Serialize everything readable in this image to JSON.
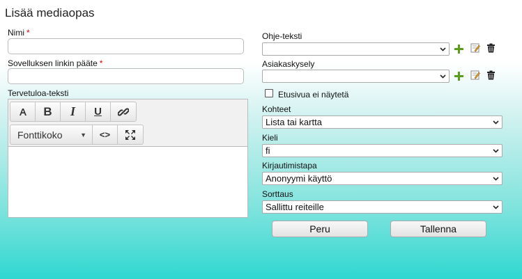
{
  "header": {
    "title": "Lisää mediaopas"
  },
  "left": {
    "name_label": "Nimi",
    "name_value": "",
    "link_label": "Sovelluksen linkin pääte",
    "link_value": "",
    "required_mark": "*",
    "welcome_label": "Tervetuloa-teksti",
    "editor": {
      "toolbar": {
        "fontsize_label": "Fonttikoko",
        "buttons": [
          "font-icon",
          "bold-icon",
          "italic-icon",
          "underline-icon",
          "link-icon",
          "code-view-icon",
          "fullscreen-icon"
        ]
      }
    }
  },
  "right": {
    "help_text_label": "Ohje-teksti",
    "help_text_value": "",
    "survey_label": "Asiakaskysely",
    "survey_value": "",
    "front_page_checkbox_label": "Etusivua ei näytetä",
    "front_page_checked": false,
    "targets_label": "Kohteet",
    "targets_value": "Lista tai kartta",
    "language_label": "Kieli",
    "language_value": "fi",
    "login_label": "Kirjautimistapa",
    "login_value": "Anonyymi käyttö",
    "sort_label": "Sorttaus",
    "sort_value": "Sallittu reiteille"
  },
  "actions": {
    "cancel": "Peru",
    "save": "Tallenna"
  },
  "colors": {
    "add": "#5a9e1e",
    "required": "#dd0000",
    "accent_bottom": "#2ed8d0"
  }
}
